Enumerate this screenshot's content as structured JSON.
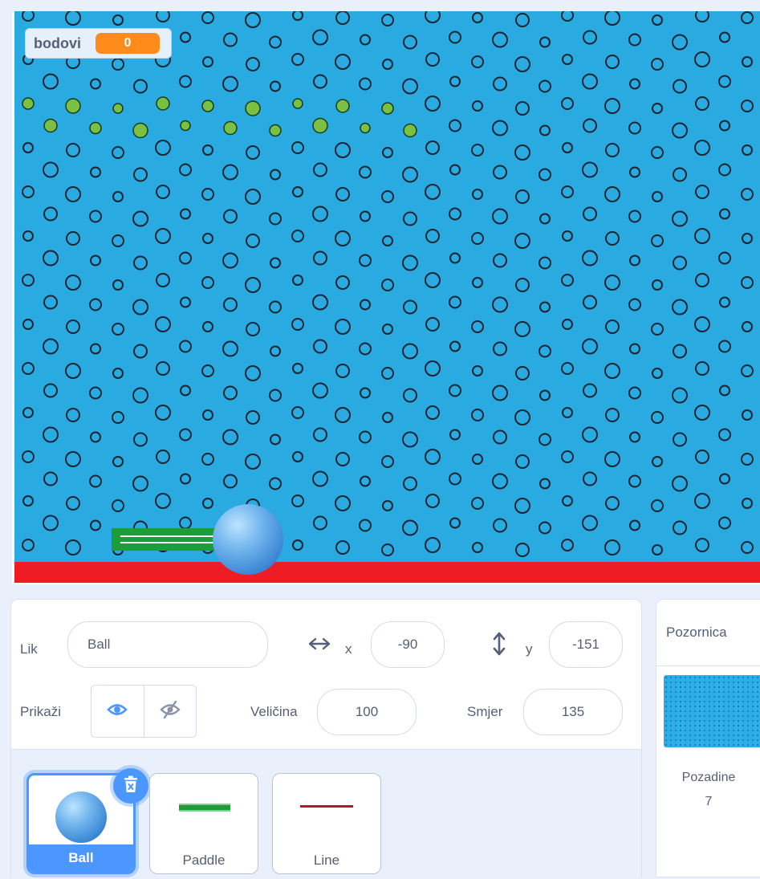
{
  "stage": {
    "monitor": {
      "label": "bodovi",
      "value": "0"
    },
    "colors": {
      "background": "#29abe2",
      "floor": "#ee1c25",
      "paddle": "#1d9c3a",
      "bricks_hit": "#7ac143"
    }
  },
  "sprite_info": {
    "sprite_label": "Lik",
    "sprite_name": "Ball",
    "x_label": "x",
    "x_value": "-90",
    "y_label": "y",
    "y_value": "-151",
    "show_label": "Prikaži",
    "size_label": "Veličina",
    "size_value": "100",
    "direction_label": "Smjer",
    "direction_value": "135"
  },
  "sprites": [
    {
      "name": "Ball",
      "selected": true
    },
    {
      "name": "Paddle",
      "selected": false
    },
    {
      "name": "Line",
      "selected": false
    }
  ],
  "stage_pane": {
    "title": "Pozornica",
    "backdrops_label": "Pozadine",
    "backdrops_count": "7"
  },
  "icons": {
    "x_arrow": "horizontal-arrows-icon",
    "y_arrow": "vertical-arrows-icon",
    "show": "eye-icon",
    "hide": "eye-slash-icon",
    "delete": "trash-icon"
  }
}
